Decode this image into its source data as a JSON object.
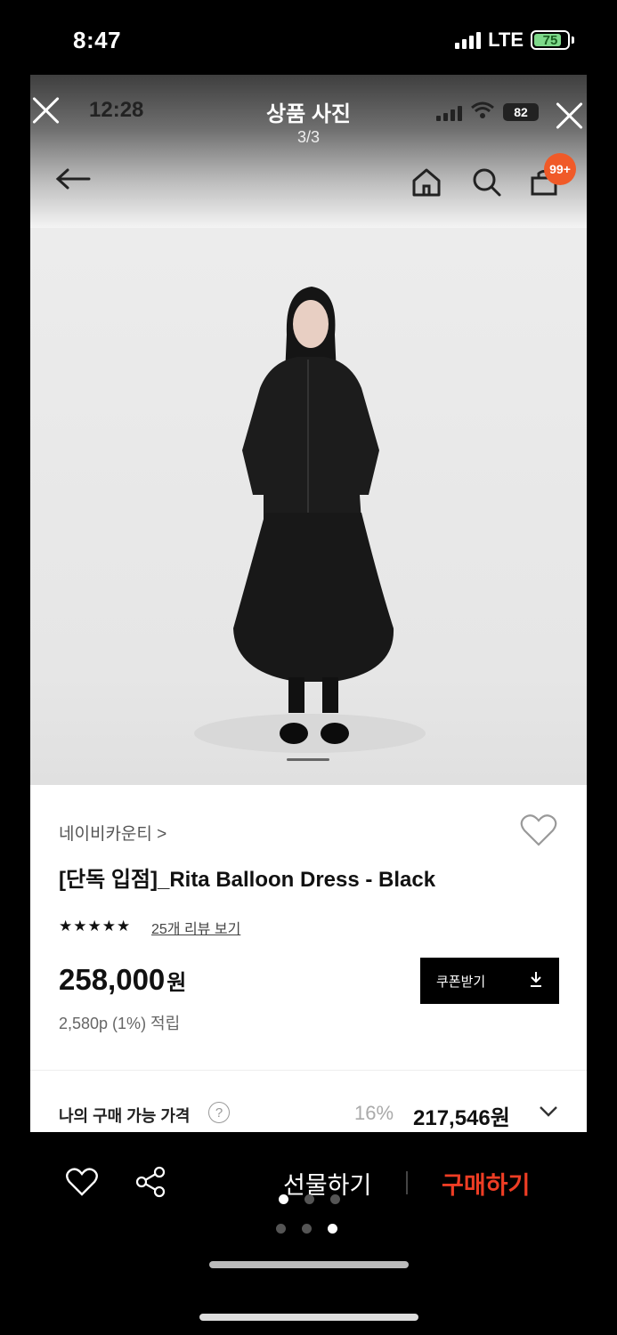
{
  "outer_status": {
    "time": "8:47",
    "network": "LTE",
    "battery": "75"
  },
  "viewer": {
    "time": "12:28",
    "title": "상품 사진",
    "count": "3/3",
    "battery": "82"
  },
  "header": {
    "cart_badge": "99+"
  },
  "product": {
    "brand": "네이비카운티 >",
    "title": "[단독 입점]_Rita Balloon Dress - Black",
    "stars": "★★★★★",
    "review_link": "25개 리뷰 보기",
    "price": "258,000",
    "price_unit": "원",
    "points": "2,580p (1%) 적립",
    "coupon_label": "쿠폰받기",
    "my_price_label": "나의 구매 가능 가격",
    "discount": "16%",
    "discount_price": "217,546원"
  },
  "bottom_bar": {
    "gift_label": "선물하기",
    "buy_label": "구매하기"
  },
  "colors": {
    "buy": "#ee3d24",
    "badge": "#f05a28",
    "battery": "#7ed98a"
  }
}
